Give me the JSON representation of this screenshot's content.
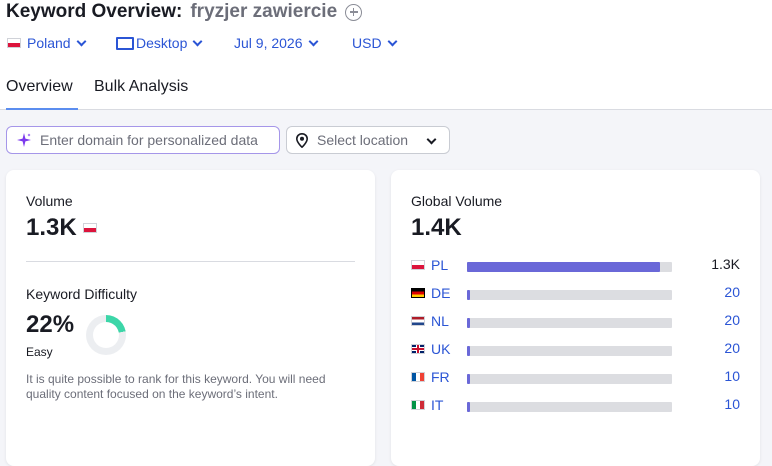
{
  "header": {
    "title": "Keyword Overview:",
    "keyword": "fryzjer zawiercie"
  },
  "filters": {
    "country": "Poland",
    "device": "Desktop",
    "date": "Jul 9, 2026",
    "currency": "USD"
  },
  "tabs": [
    {
      "label": "Overview",
      "active": true
    },
    {
      "label": "Bulk Analysis",
      "active": false
    }
  ],
  "domain_input": {
    "placeholder": "Enter domain for personalized data"
  },
  "location_select": {
    "placeholder": "Select location"
  },
  "volume_card": {
    "volume_label": "Volume",
    "volume_value": "1.3K",
    "kd_label": "Keyword Difficulty",
    "kd_value": "22%",
    "kd_percent": 22,
    "kd_level": "Easy",
    "kd_description": "It is quite possible to rank for this keyword. You will need quality content focused on the keyword’s intent.",
    "kd_color": "#3cd6a8"
  },
  "global_card": {
    "label": "Global Volume",
    "value": "1.4K",
    "bar_color": "#6a68d8",
    "countries": [
      {
        "code": "PL",
        "flag": "pl",
        "value": "1.3K",
        "share": 0.94
      },
      {
        "code": "DE",
        "flag": "de",
        "value": "20",
        "share": 0.015
      },
      {
        "code": "NL",
        "flag": "nl",
        "value": "20",
        "share": 0.015
      },
      {
        "code": "UK",
        "flag": "uk",
        "value": "20",
        "share": 0.015
      },
      {
        "code": "FR",
        "flag": "fr",
        "value": "10",
        "share": 0.01
      },
      {
        "code": "IT",
        "flag": "it",
        "value": "10",
        "share": 0.01
      }
    ]
  },
  "colors": {
    "link": "#2b55d5",
    "tab_underline": "#5b8def"
  }
}
